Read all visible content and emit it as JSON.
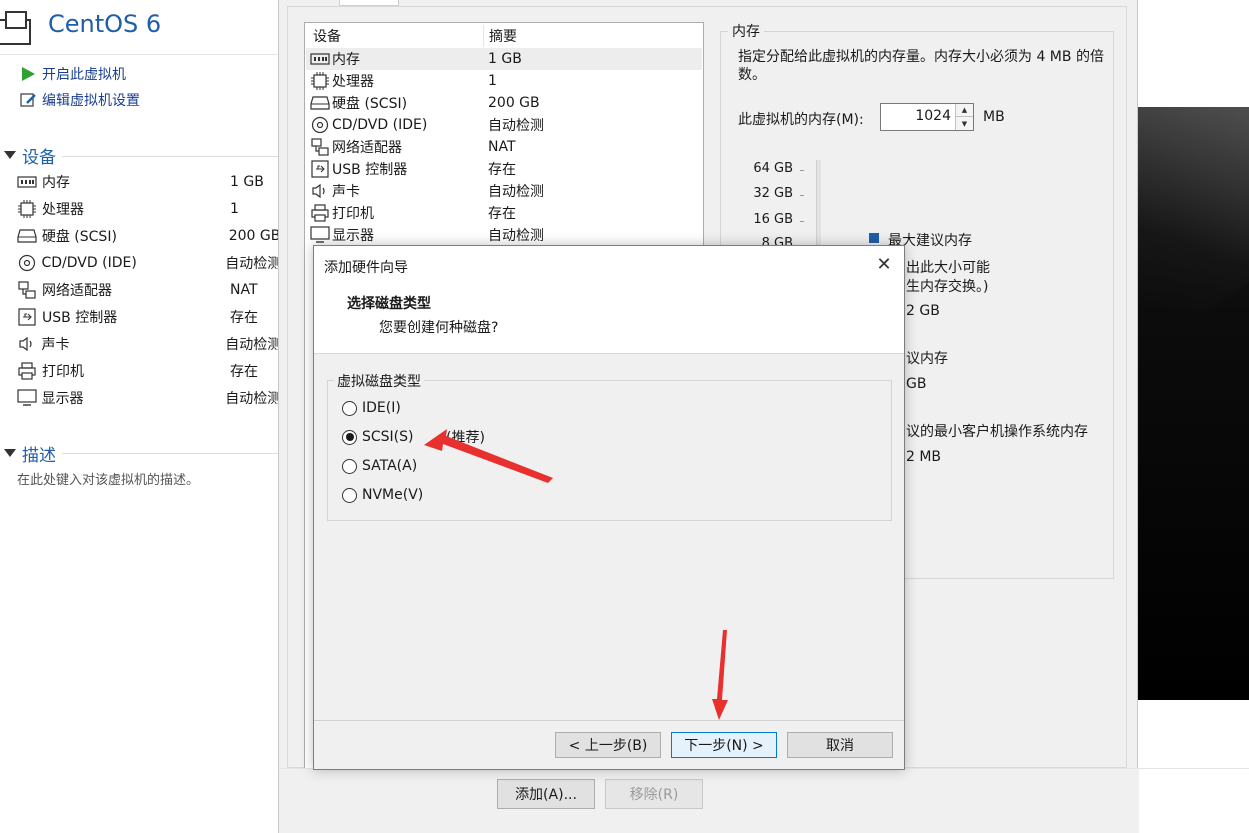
{
  "left_panel": {
    "vm_name": "CentOS 6",
    "commands": [
      {
        "label": "开启此虚拟机",
        "icon": "play-icon"
      },
      {
        "label": "编辑虚拟机设置",
        "icon": "edit-settings-icon"
      }
    ],
    "devices_header": "设备",
    "devices": [
      {
        "name": "内存",
        "value": "1 GB",
        "icon": "memory-icon"
      },
      {
        "name": "处理器",
        "value": "1",
        "icon": "cpu-icon"
      },
      {
        "name": "硬盘 (SCSI)",
        "value": "200 GB",
        "icon": "hard-disk-icon"
      },
      {
        "name": "CD/DVD (IDE)",
        "value": "自动检测",
        "icon": "cd-dvd-icon"
      },
      {
        "name": "网络适配器",
        "value": "NAT",
        "icon": "network-adapter-icon"
      },
      {
        "name": "USB 控制器",
        "value": "存在",
        "icon": "usb-icon"
      },
      {
        "name": "声卡",
        "value": "自动检测",
        "icon": "sound-icon"
      },
      {
        "name": "打印机",
        "value": "存在",
        "icon": "printer-icon"
      },
      {
        "name": "显示器",
        "value": "自动检测",
        "icon": "display-icon"
      }
    ],
    "description_header": "描述",
    "description_placeholder": "在此处键入对该虚拟机的描述。"
  },
  "settings": {
    "device_list": {
      "columns": [
        "设备",
        "摘要"
      ],
      "rows": [
        {
          "name": "内存",
          "value": "1 GB",
          "icon": "memory-icon",
          "selected": true
        },
        {
          "name": "处理器",
          "value": "1",
          "icon": "cpu-icon"
        },
        {
          "name": "硬盘 (SCSI)",
          "value": "200 GB",
          "icon": "hard-disk-icon"
        },
        {
          "name": "CD/DVD (IDE)",
          "value": "自动检测",
          "icon": "cd-dvd-icon"
        },
        {
          "name": "网络适配器",
          "value": "NAT",
          "icon": "network-adapter-icon"
        },
        {
          "name": "USB 控制器",
          "value": "存在",
          "icon": "usb-icon"
        },
        {
          "name": "声卡",
          "value": "自动检测",
          "icon": "sound-icon"
        },
        {
          "name": "打印机",
          "value": "存在",
          "icon": "printer-icon"
        },
        {
          "name": "显示器",
          "value": "自动检测",
          "icon": "display-icon"
        }
      ]
    },
    "memory": {
      "legend": "内存",
      "description": "指定分配给此虚拟机的内存量。内存大小必须为 4 MB 的倍数。",
      "label": "此虚拟机的内存(M):",
      "value": "1024",
      "unit": "MB",
      "scale_labels": [
        "64 GB",
        "32 GB",
        "16 GB",
        "8 GB"
      ],
      "notes": [
        "最大建议内存",
        "出此大小可能",
        "生内存交换。)",
        "2 GB",
        "议内存",
        "GB",
        "议的最小客户机操作系统内存",
        "2 MB"
      ]
    },
    "add_button": "添加(A)...",
    "remove_button": "移除(R)"
  },
  "wizard": {
    "title": "添加硬件向导",
    "heading": "选择磁盘类型",
    "subheading": "您要创建何种磁盘?",
    "group_label": "虚拟磁盘类型",
    "options": [
      {
        "label": "IDE(I)",
        "selected": false
      },
      {
        "label": "SCSI(S)",
        "selected": true
      },
      {
        "label": "SATA(A)",
        "selected": false
      },
      {
        "label": "NVMe(V)",
        "selected": false
      }
    ],
    "recommend_label": "(推荐)",
    "back_button": "< 上一步(B)",
    "next_button": "下一步(N) >",
    "cancel_button": "取消",
    "close_glyph": "✕"
  },
  "colors": {
    "accent": "#1f5fa8",
    "arrow": "#e8302f"
  }
}
